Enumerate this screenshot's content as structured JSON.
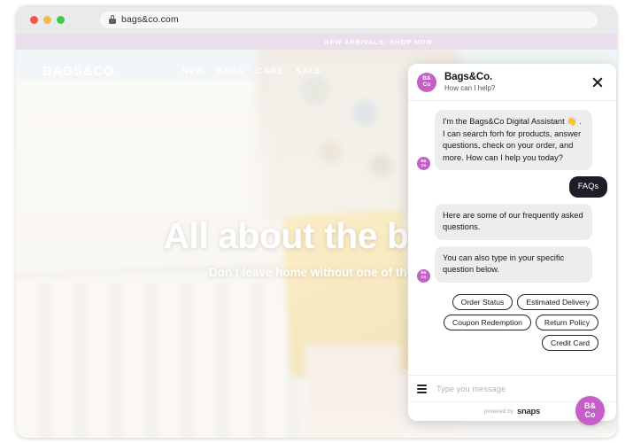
{
  "browser": {
    "url": "bags&co.com",
    "lock_icon": "lock-icon",
    "traffic_lights": [
      "close-red",
      "minimize-yellow",
      "maximize-green"
    ]
  },
  "site": {
    "announcement": "NEW ARRIVALS: SHOP NOW",
    "logo": "BAGS&CO.",
    "nav": [
      {
        "label": "NEW"
      },
      {
        "label": "BAGS"
      },
      {
        "label": "CARE"
      },
      {
        "label": "SALE"
      }
    ],
    "hero": {
      "title": "All about the bags",
      "subtitle": "Don't leave home without one of them"
    }
  },
  "chat": {
    "avatar_top": "B&",
    "avatar_bottom": "Co",
    "title": "Bags&Co.",
    "subtitle": "How can I help?",
    "close_icon": "close-icon",
    "messages": [
      {
        "sender": "bot",
        "text": "I'm the Bags&Co Digital Assistant 👋 . I can search forh for products, answer questions, check on your order, and more. How can I help you today?"
      },
      {
        "sender": "user",
        "text": "FAQs"
      },
      {
        "sender": "bot",
        "text": "Here are some of our frequently asked questions."
      },
      {
        "sender": "bot",
        "text": "You can also type in your specific question below."
      }
    ],
    "quick_replies": [
      {
        "label": "Order Status"
      },
      {
        "label": "Estimated Delivery"
      },
      {
        "label": "Coupon Redemption"
      },
      {
        "label": "Return Policy"
      },
      {
        "label": "Credit Card"
      }
    ],
    "input": {
      "menu_icon": "hamburger-menu-icon",
      "placeholder": "Type you message",
      "value": ""
    },
    "footer": {
      "powered_by": "powered by",
      "brand": "snaps"
    },
    "launcher": {
      "top": "B&",
      "bottom": "Co"
    },
    "colors": {
      "brand_purple": "#c35fc6",
      "user_bubble": "#1c1d26",
      "bot_bubble": "#ededed",
      "announcement_bar": "#eadeec"
    }
  }
}
